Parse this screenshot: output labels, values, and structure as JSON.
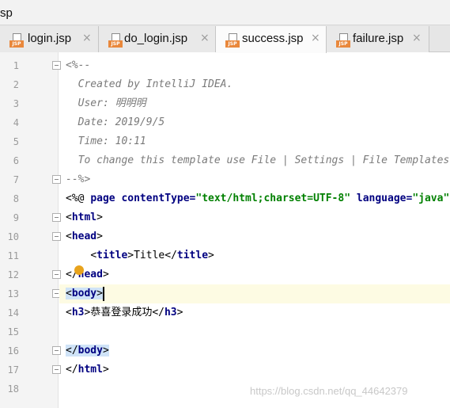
{
  "window": {
    "title": "sp"
  },
  "tabs": [
    {
      "label": "login.jsp",
      "icon_text": "JSP",
      "active": false
    },
    {
      "label": "do_login.jsp",
      "icon_text": "JSP",
      "active": false
    },
    {
      "label": "success.jsp",
      "icon_text": "JSP",
      "active": true
    },
    {
      "label": "failure.jsp",
      "icon_text": "JSP",
      "active": false
    }
  ],
  "tab_close_glyph": "×",
  "line_numbers": [
    "1",
    "2",
    "3",
    "4",
    "5",
    "6",
    "7",
    "8",
    "9",
    "10",
    "11",
    "12",
    "13",
    "14",
    "15",
    "16",
    "17",
    "18"
  ],
  "code": {
    "l1": "<%--",
    "l2": "  Created by IntelliJ IDEA.",
    "l3": "  User: 明明明",
    "l4": "  Date: 2019/9/5",
    "l5": "  Time: 10:11",
    "l6": "  To change this template use File | Settings | File Templates.",
    "l7": "--%>",
    "l8": {
      "open": "<%@ ",
      "page": "page",
      "attr1": " contentType=",
      "val1": "\"text/html;charset=UTF-8\"",
      "attr2": " language=",
      "val2": "\"java\""
    },
    "l9": {
      "lt": "<",
      "tag": "html",
      "gt": ">"
    },
    "l10": {
      "lt": "<",
      "tag": "head",
      "gt": ">"
    },
    "l11": {
      "indent": "    ",
      "open_lt": "<",
      "open_tag": "title",
      "open_gt": ">",
      "text": "Title",
      "close_lt": "</",
      "close_tag": "title",
      "close_gt": ">"
    },
    "l12": {
      "lt": "</",
      "tag": "head",
      "gt": ">"
    },
    "l13": {
      "lt": "<",
      "tag": "body",
      "gt": ">"
    },
    "l14": {
      "open_lt": "<",
      "open_tag": "h3",
      "open_gt": ">",
      "text": "恭喜登录成功",
      "close_lt": "</",
      "close_tag": "h3",
      "close_gt": ">"
    },
    "l16": {
      "lt": "</",
      "tag": "body",
      "gt": ">"
    },
    "l17": {
      "lt": "</",
      "tag": "html",
      "gt": ">"
    }
  },
  "watermark": "https://blog.csdn.net/qq_44642379",
  "colors": {
    "jsp_badge": "#e9883c",
    "tag": "#000080",
    "string": "#008000",
    "comment": "#7a7a7a",
    "selection": "#cfe3f7",
    "breakpoint": "#e8a31c"
  }
}
